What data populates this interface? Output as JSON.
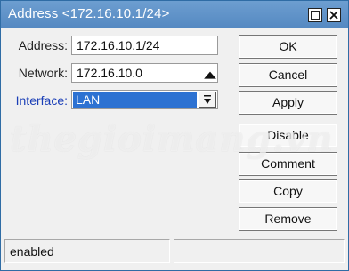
{
  "window": {
    "title": "Address <172.16.10.1/24>",
    "titlebar_buttons": [
      "maximize-icon",
      "close-icon"
    ]
  },
  "form": {
    "address": {
      "label": "Address:",
      "value": "172.16.10.1/24"
    },
    "network": {
      "label": "Network:",
      "value": "172.16.10.0",
      "icon": "up-triangle-icon"
    },
    "interface": {
      "label": "Interface:",
      "value": "LAN",
      "icon": "dropdown-arrow-icon"
    }
  },
  "buttons": {
    "ok": "OK",
    "cancel": "Cancel",
    "apply": "Apply",
    "disable": "Disable",
    "comment": "Comment",
    "copy": "Copy",
    "remove": "Remove"
  },
  "watermark": "thegioimang.vn",
  "status": {
    "text": "enabled",
    "secondary": ""
  },
  "colors": {
    "titlebar": "#5b8fc7",
    "selection": "#2d72d2",
    "label_accent": "#1b3fb7"
  }
}
